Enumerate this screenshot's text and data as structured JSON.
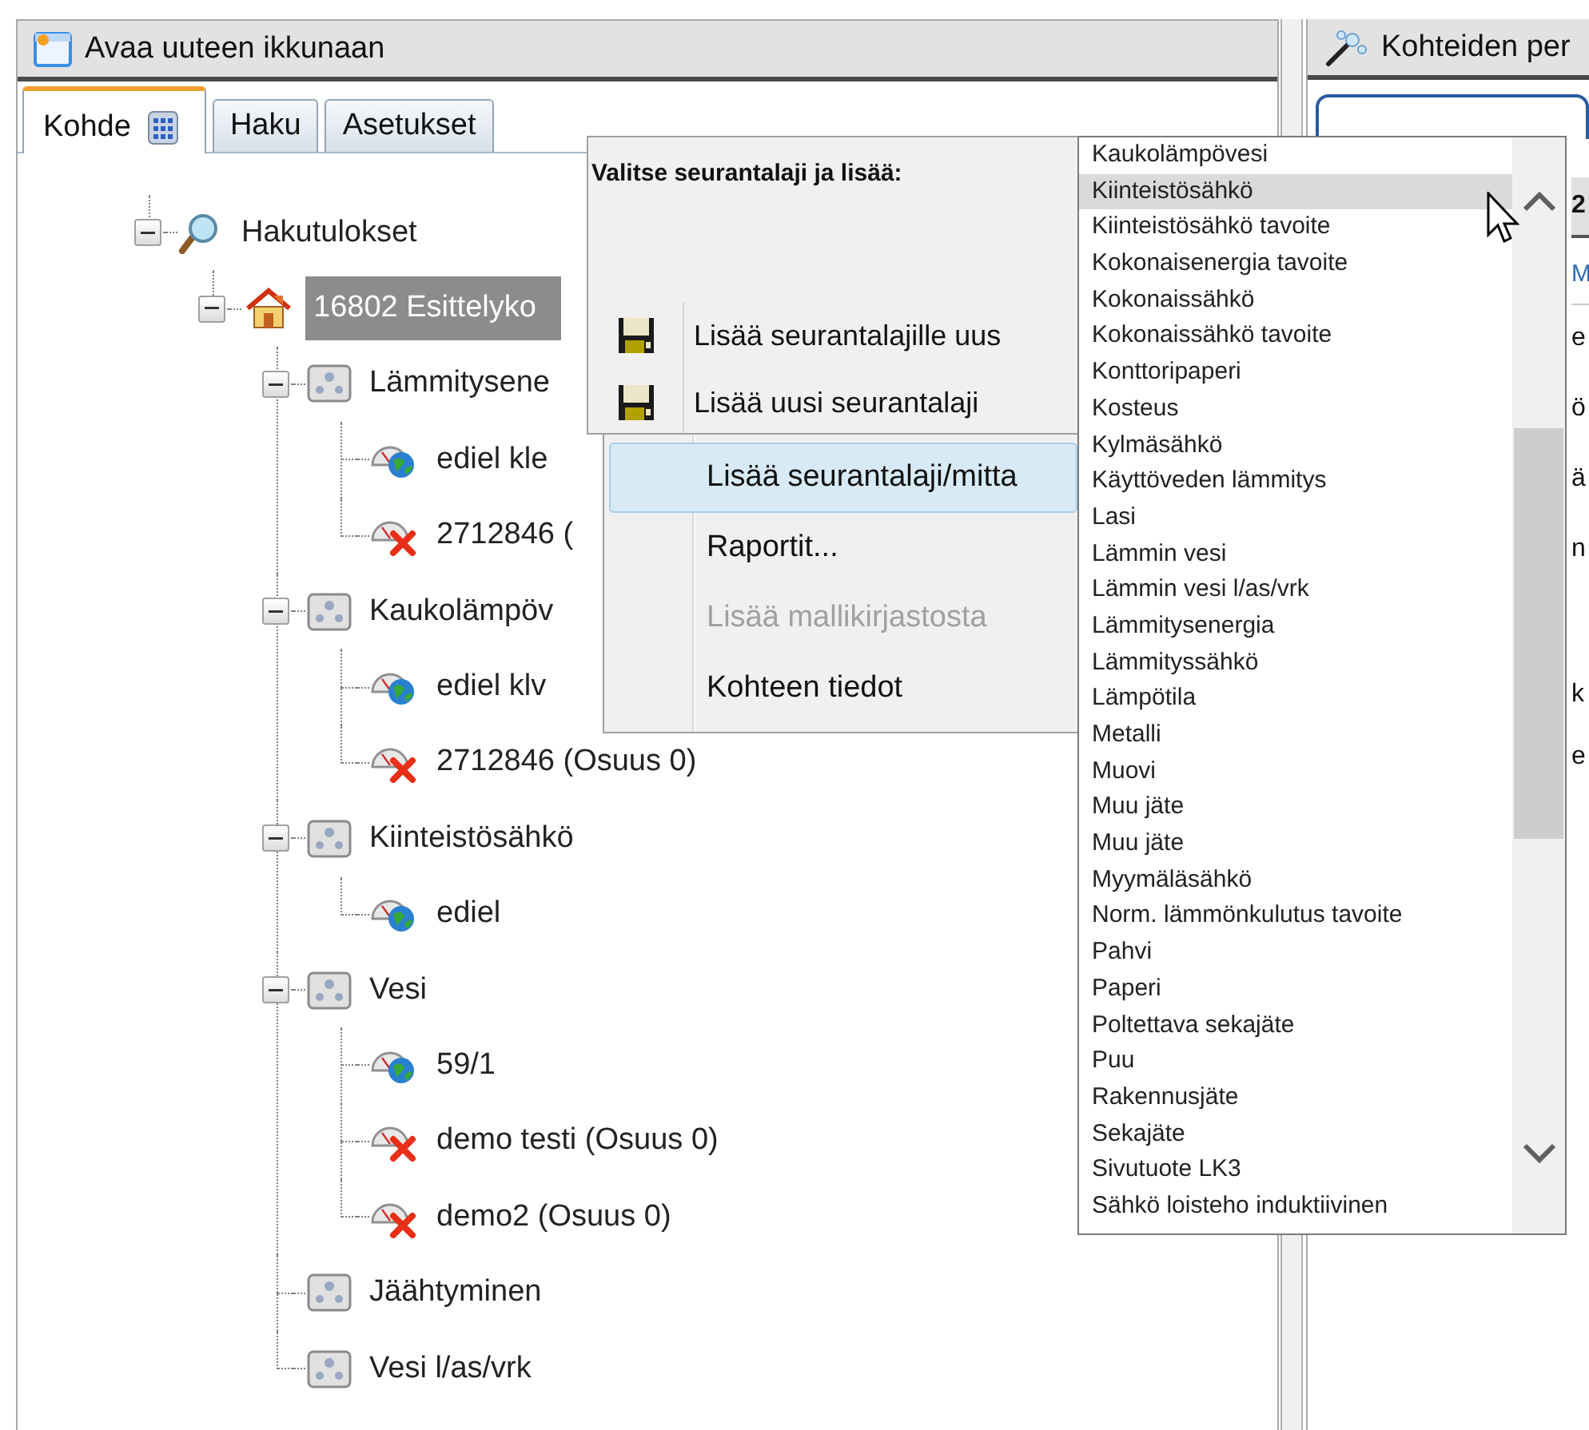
{
  "left_panel": {
    "header": {
      "title": "Avaa uuteen ikkunaan"
    },
    "tabs": [
      {
        "label": "Kohde",
        "selected": true,
        "kind": "with_icon"
      },
      {
        "label": "Haku",
        "selected": false,
        "kind": "plain"
      },
      {
        "label": "Asetukset",
        "selected": false,
        "kind": "plain"
      }
    ],
    "tree": [
      {
        "label": "Hakutulokset",
        "kind": "search",
        "expanded": true,
        "selected": false,
        "children": [
          {
            "label": "16802 Esittelyko",
            "kind": "house",
            "expanded": true,
            "selected": true,
            "children": [
              {
                "label": "Lämmitysene",
                "kind": "group",
                "expanded": true,
                "selected": false,
                "children": [
                  {
                    "label": "ediel kle",
                    "kind": "meter_ok",
                    "selected": false
                  },
                  {
                    "label": "2712846 (",
                    "kind": "meter_error",
                    "selected": false
                  }
                ]
              },
              {
                "label": "Kaukolämpöv",
                "kind": "group",
                "expanded": true,
                "selected": false,
                "children": [
                  {
                    "label": "ediel klv",
                    "kind": "meter_ok",
                    "selected": false
                  },
                  {
                    "label": "2712846 (Osuus 0)",
                    "kind": "meter_error",
                    "selected": false
                  }
                ]
              },
              {
                "label": "Kiinteistösähkö",
                "kind": "group",
                "expanded": true,
                "selected": false,
                "children": [
                  {
                    "label": "ediel",
                    "kind": "meter_ok",
                    "selected": false
                  }
                ]
              },
              {
                "label": "Vesi",
                "kind": "group",
                "expanded": true,
                "selected": false,
                "children": [
                  {
                    "label": "59/1",
                    "kind": "meter_ok",
                    "selected": false
                  },
                  {
                    "label": "demo testi (Osuus 0)",
                    "kind": "meter_error",
                    "selected": false
                  },
                  {
                    "label": "demo2 (Osuus 0)",
                    "kind": "meter_error",
                    "selected": false
                  }
                ]
              },
              {
                "label": "Jäähtyminen",
                "kind": "group",
                "selected": false
              },
              {
                "label": "Vesi l/as/vrk",
                "kind": "group",
                "selected": false
              }
            ]
          }
        ]
      }
    ]
  },
  "right_panel": {
    "header": {
      "title": "Kohteiden per"
    },
    "bar_text": "2",
    "link": "M",
    "lines": [
      "e",
      "ö",
      "ä",
      "n"
    ],
    "lines_lower": [
      "k",
      "e"
    ]
  },
  "add_panel": {
    "heading": "Valitse seurantalaji ja lisää:",
    "items": [
      {
        "label": "Lisää seurantalajille uus",
        "selected": false
      },
      {
        "label": "Lisää uusi seurantalaji",
        "selected": false
      }
    ]
  },
  "context_menu": {
    "items": [
      {
        "label": "Lisää seurantalaji/mitta",
        "selected": true,
        "disabled": false
      },
      {
        "label": "Raportit...",
        "selected": false,
        "disabled": false
      },
      {
        "label": "Lisää mallikirjastosta",
        "selected": false,
        "disabled": true
      },
      {
        "label": "Kohteen tiedot",
        "selected": false,
        "disabled": false
      }
    ]
  },
  "dropdown": {
    "items": [
      {
        "label": "Kaukolämpövesi",
        "selected": false
      },
      {
        "label": "Kiinteistösähkö",
        "selected": true
      },
      {
        "label": "Kiinteistösähkö tavoite",
        "selected": false
      },
      {
        "label": "Kokonaisenergia tavoite",
        "selected": false
      },
      {
        "label": "Kokonaissähkö",
        "selected": false
      },
      {
        "label": "Kokonaissähkö tavoite",
        "selected": false
      },
      {
        "label": "Konttoripaperi",
        "selected": false
      },
      {
        "label": "Kosteus",
        "selected": false
      },
      {
        "label": "Kylmäsähkö",
        "selected": false
      },
      {
        "label": "Käyttöveden lämmitys",
        "selected": false
      },
      {
        "label": "Lasi",
        "selected": false
      },
      {
        "label": "Lämmin vesi",
        "selected": false
      },
      {
        "label": "Lämmin vesi l/as/vrk",
        "selected": false
      },
      {
        "label": "Lämmitysenergia",
        "selected": false
      },
      {
        "label": "Lämmityssähkö",
        "selected": false
      },
      {
        "label": "Lämpötila",
        "selected": false
      },
      {
        "label": "Metalli",
        "selected": false
      },
      {
        "label": "Muovi",
        "selected": false
      },
      {
        "label": "Muu jäte",
        "selected": false
      },
      {
        "label": "Muu jäte",
        "selected": false
      },
      {
        "label": "Myymäläsähkö",
        "selected": false
      },
      {
        "label": "Norm. lämmönkulutus tavoite",
        "selected": false
      },
      {
        "label": "Pahvi",
        "selected": false
      },
      {
        "label": "Paperi",
        "selected": false
      },
      {
        "label": "Poltettava sekajäte",
        "selected": false
      },
      {
        "label": "Puu",
        "selected": false
      },
      {
        "label": "Rakennusjäte",
        "selected": false
      },
      {
        "label": "Sekajäte",
        "selected": false
      },
      {
        "label": "Sivutuote LK3",
        "selected": false
      },
      {
        "label": "Sähkö loisteho induktiivinen",
        "selected": false
      }
    ]
  }
}
